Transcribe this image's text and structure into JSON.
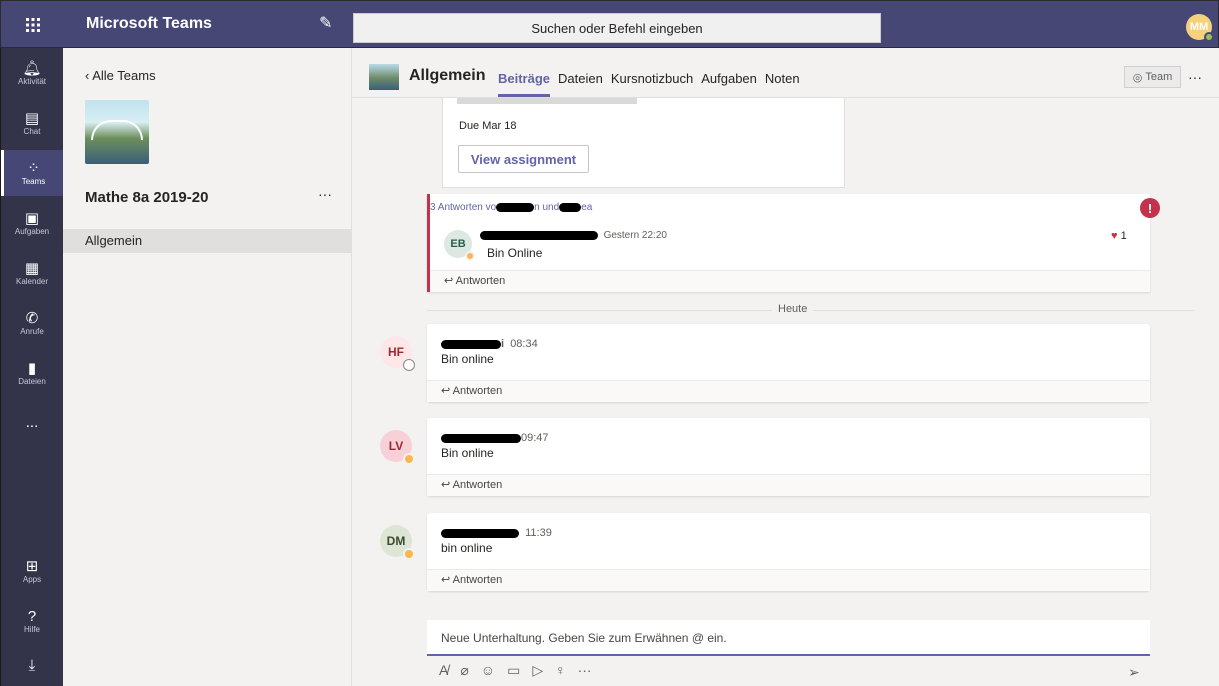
{
  "topbar": {
    "app_title": "Microsoft Teams",
    "search_placeholder": "Suchen oder Befehl eingeben",
    "user_initials": "MM"
  },
  "rail": {
    "items": [
      {
        "label": "Aktivität",
        "icon": "bell-icon"
      },
      {
        "label": "Chat",
        "icon": "chat-icon"
      },
      {
        "label": "Teams",
        "icon": "teams-icon"
      },
      {
        "label": "Aufgaben",
        "icon": "assignments-icon"
      },
      {
        "label": "Kalender",
        "icon": "calendar-icon"
      },
      {
        "label": "Anrufe",
        "icon": "phone-icon"
      },
      {
        "label": "Dateien",
        "icon": "files-icon"
      },
      {
        "label": "...",
        "icon": "more-icon"
      }
    ],
    "bottom": [
      {
        "label": "Apps",
        "icon": "apps-icon"
      },
      {
        "label": "Hilfe",
        "icon": "help-icon"
      }
    ]
  },
  "team": {
    "back_label": "Alle Teams",
    "name": "Mathe 8a 2019-20",
    "channel": "Allgemein"
  },
  "channel_header": {
    "title": "Allgemein",
    "tabs": [
      "Beiträge",
      "Dateien",
      "Kursnotizbuch",
      "Aufgaben",
      "Noten"
    ],
    "team_button": "Team"
  },
  "assignment": {
    "due": "Due Mar 18",
    "button": "View assignment"
  },
  "thread": {
    "replies_text_start": "3 Antworten vo",
    "replies_text_mid": "n und",
    "replies_text_end": "ea",
    "reply_initials": "EB",
    "reply_time": "Gestern 22:20",
    "reply_text": "Bin Online",
    "reaction_count": "1",
    "reply_label": "Antworten"
  },
  "divider": {
    "label": "Heute"
  },
  "messages": [
    {
      "initials": "HF",
      "name_suffix": "i",
      "time": "08:34",
      "text": "Bin online",
      "reply_label": "Antworten",
      "avatar_bg": "#fde7e9",
      "avatar_fg": "#a4262c"
    },
    {
      "initials": "LV",
      "name_suffix": "",
      "time": "09:47",
      "text": "Bin online",
      "reply_label": "Antworten",
      "avatar_bg": "#f8d0d8",
      "avatar_fg": "#a4262c"
    },
    {
      "initials": "DM",
      "name_suffix": "",
      "time": "11:39",
      "text": "bin online",
      "reply_label": "Antworten",
      "avatar_bg": "#dde5d5",
      "avatar_fg": "#3a4a2e"
    }
  ],
  "composer": {
    "placeholder": "Neue Unterhaltung. Geben Sie zum Erwähnen @ ein."
  }
}
